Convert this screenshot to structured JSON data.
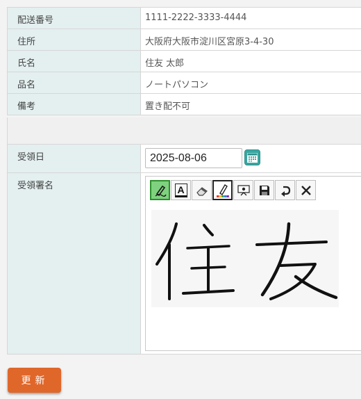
{
  "delivery": {
    "rows": [
      {
        "label": "配送番号",
        "value": "1111-2222-3333-4444"
      },
      {
        "label": "住所",
        "value": "大阪府大阪市淀川区宮原3-4-30"
      },
      {
        "label": "氏名",
        "value": "住友 太郎"
      },
      {
        "label": "品名",
        "value": "ノートパソコン"
      },
      {
        "label": "備考",
        "value": "置き配不可"
      }
    ]
  },
  "receipt": {
    "date_label": "受領日",
    "date_value": "2025-08-06",
    "signature_label": "受領署名",
    "signature_text": "住友",
    "tools": [
      {
        "icon": "pen-icon",
        "state": "active"
      },
      {
        "icon": "text-icon",
        "label": "A",
        "state": "normal"
      },
      {
        "icon": "eraser-icon",
        "state": "normal"
      },
      {
        "icon": "color-pen-icon",
        "state": "selected"
      },
      {
        "icon": "presentation-icon",
        "state": "normal"
      },
      {
        "icon": "save-icon",
        "state": "normal"
      },
      {
        "icon": "undo-icon",
        "state": "normal"
      },
      {
        "icon": "clear-icon",
        "state": "normal"
      }
    ],
    "palette": [
      "#e53935",
      "#fbc02d",
      "#43a047",
      "#1e88e5",
      "#8e24aa"
    ]
  },
  "actions": {
    "update_label": "更新"
  },
  "colors": {
    "label_bg": "#e4efef",
    "accent": "#e0672a",
    "calendar": "#3aa6a0",
    "active_tool": "#7fd17f"
  }
}
